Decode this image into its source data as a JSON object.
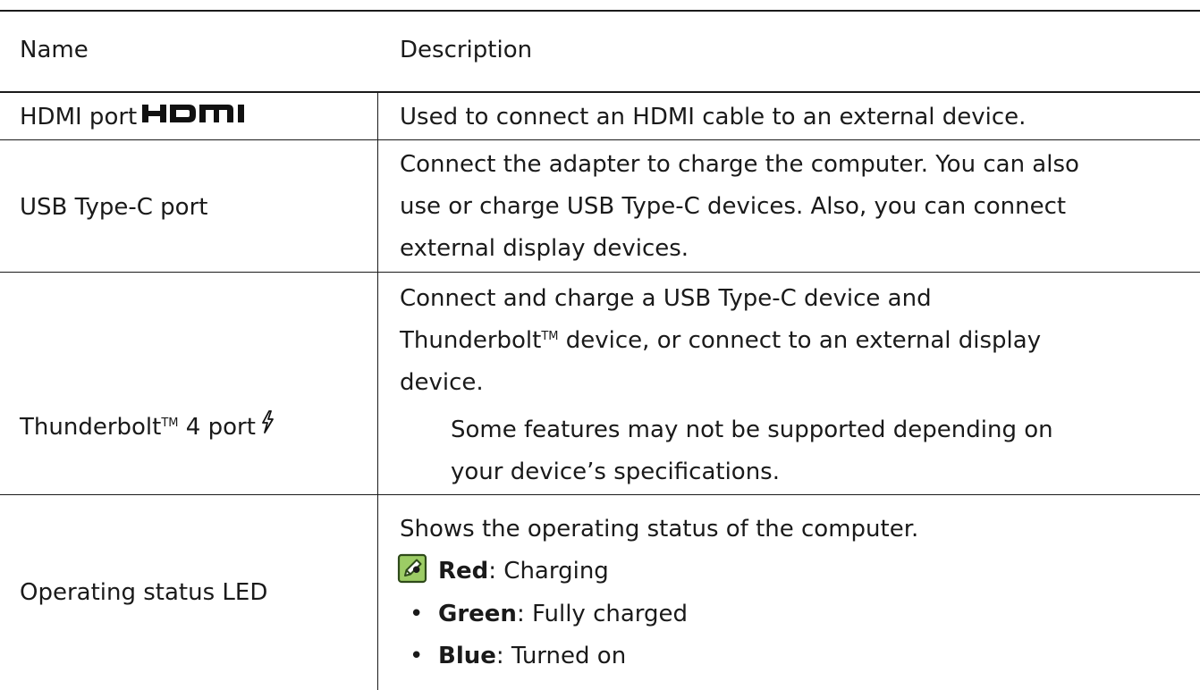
{
  "table": {
    "header": {
      "name": "Name",
      "description": "Description"
    },
    "rows": [
      {
        "name": "HDMI port",
        "icon": "hdmi-logo-icon",
        "description": "Used to connect an HDMI cable to an external device."
      },
      {
        "name": "USB Type-C port",
        "description_lines": [
          "Connect the adapter to charge the computer. You can also",
          "use or charge USB Type-C devices. Also, you can connect",
          "external display devices."
        ]
      },
      {
        "name": "Thunderbolt",
        "name_tm": "TM",
        "name_suffix": " 4 port",
        "icon": "thunderbolt-icon",
        "description_line1": "Connect and charge a USB Type-C device and",
        "description_line2_prefix": "Thunderbolt",
        "description_line2_tm": "TM",
        "description_line2_suffix": " device, or connect to an external display",
        "description_line3": "device.",
        "note_icon": "note-pencil-icon",
        "note_lines": [
          "Some features may not be supported depending on",
          "your device’s specifications."
        ]
      },
      {
        "name": "Operating status LED",
        "description": "Shows the operating status of the computer.",
        "bullets": [
          {
            "label": "Red",
            "text": ": Charging"
          },
          {
            "label": "Green",
            "text": ": Fully charged"
          },
          {
            "label": "Blue",
            "text": ": Turned on"
          }
        ]
      }
    ]
  },
  "colors": {
    "text": "#1a1a1a",
    "note_icon_fill": "#7cb342",
    "note_icon_stroke": "#2e4a1a"
  }
}
